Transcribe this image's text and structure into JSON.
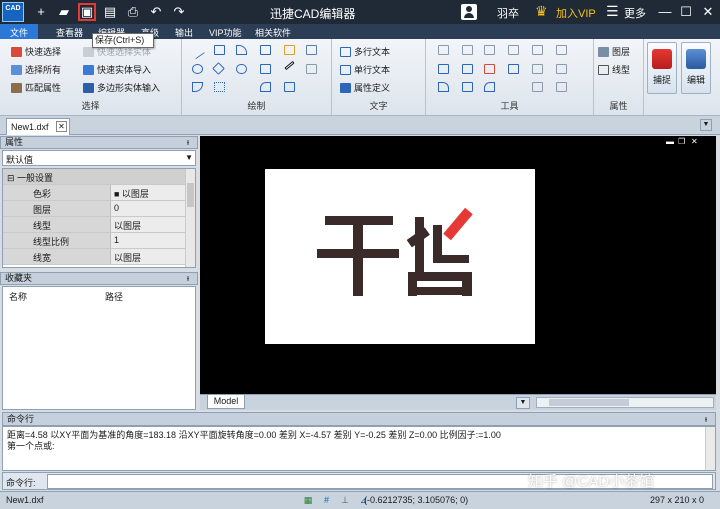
{
  "app": {
    "title": "迅捷CAD编辑器",
    "logo_text": "CAD",
    "user_name": "羽卒",
    "vip_label": "加入VIP",
    "more_label": "更多"
  },
  "quick_access": {
    "tooltip": "保存(Ctrl+S)"
  },
  "menu": {
    "items": [
      "文件",
      "查看器",
      "编辑器",
      "高级",
      "输出",
      "VIP功能",
      "相关软件"
    ],
    "active": "文件"
  },
  "ribbon": {
    "select_group": {
      "label": "选择",
      "items": [
        "快速选择",
        "选择所有",
        "匹配属性",
        "快速选择实体",
        "快速实体导入",
        "多边形实体输入"
      ]
    },
    "draw_group": {
      "label": "绘制"
    },
    "text_group": {
      "label": "文字",
      "items": [
        "多行文本",
        "单行文本",
        "属性定义"
      ]
    },
    "tools_group": {
      "label": "工具"
    },
    "props_group": {
      "label": "属性",
      "items": [
        "图层",
        "线型"
      ]
    },
    "big_buttons": [
      "捕捉",
      "编辑"
    ]
  },
  "document_tab": {
    "label": "New1.dxf"
  },
  "properties_panel": {
    "title": "属性",
    "selected_value": "默认值",
    "category": "一般设置",
    "rows": [
      {
        "key": "色彩",
        "value": "■ 以图层"
      },
      {
        "key": "图层",
        "value": "0"
      },
      {
        "key": "线型",
        "value": "以图层"
      },
      {
        "key": "线型比例",
        "value": "1"
      },
      {
        "key": "线宽",
        "value": "以图层"
      }
    ]
  },
  "favorites_panel": {
    "title": "收藏夹",
    "columns": [
      "名称",
      "路径"
    ]
  },
  "canvas": {
    "drawing_text": "干货",
    "model_tab": "Model",
    "accent_color": "#e53935",
    "drawing_color": "#3a2a2a"
  },
  "command_panel": {
    "title": "命令行",
    "lines": [
      "距离=4.58  以XY平面为基准的角度=183.18  沿XY平面旋转角度=0.00  差别 X=-4.57  差别 Y=-0.25  差别 Z=0.00  比例因子:=1.00",
      "第一个点或:"
    ],
    "prompt": "命令行:"
  },
  "watermark": "知乎 @CAD小茶馆",
  "status": {
    "file": "New1.dxf",
    "coords": "(-0.6212735; 3.105076; 0)",
    "paper_size": "297 x 210 x 0"
  }
}
